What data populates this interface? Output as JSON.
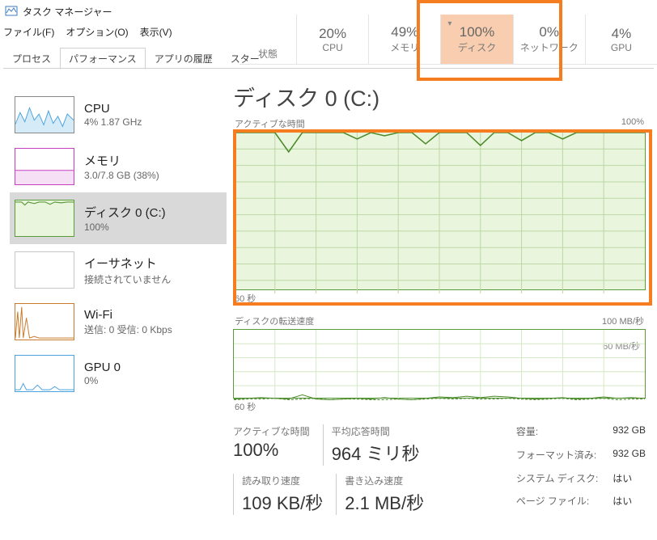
{
  "window": {
    "title": "タスク マネージャー"
  },
  "menu": {
    "file": "ファイル(F)",
    "options": "オプション(O)",
    "view": "表示(V)"
  },
  "tabs": {
    "processes": "プロセス",
    "performance": "パフォーマンス",
    "history": "アプリの履歴",
    "startup": "スター"
  },
  "top_metrics": {
    "status_label": "状態",
    "cpu": {
      "val": "20%",
      "label": "CPU"
    },
    "memory": {
      "val": "49%",
      "label": "メモリ"
    },
    "disk": {
      "val": "100%",
      "label": "ディスク"
    },
    "net": {
      "val": "0%",
      "label": "ネットワーク"
    },
    "gpu": {
      "val": "4%",
      "label": "GPU"
    }
  },
  "sidebar": [
    {
      "title": "CPU",
      "sub": "4% 1.87 GHz",
      "color": "#4aa3df",
      "fill": "#d6ebf8"
    },
    {
      "title": "メモリ",
      "sub": "3.0/7.8 GB (38%)",
      "color": "#c63fbf",
      "fill": "#f6e0f5"
    },
    {
      "title": "ディスク 0 (C:)",
      "sub": "100%",
      "color": "#5a9a3a",
      "fill": "#eaf5de"
    },
    {
      "title": "イーサネット",
      "sub": "接続されていません",
      "color": "#b0b0b0",
      "fill": "#ffffff"
    },
    {
      "title": "Wi-Fi",
      "sub": "送信: 0 受信: 0 Kbps",
      "color": "#c97a2b",
      "fill": "#fff"
    },
    {
      "title": "GPU 0",
      "sub": "0%",
      "color": "#4aa3df",
      "fill": "#fff"
    }
  ],
  "page": {
    "title": "ディスク 0 (C:)",
    "chart1_label": "アクティブな時間",
    "chart1_max": "100%",
    "chart1_x": "60 秒",
    "chart2_label": "ディスクの転送速度",
    "chart2_max": "100 MB/秒",
    "chart2_y2": "60 MB/秒",
    "chart2_x": "60 秒"
  },
  "stats": {
    "active_label": "アクティブな時間",
    "active_value": "100%",
    "avg_label": "平均応答時間",
    "avg_value": "964 ミリ秒",
    "read_label": "読み取り速度",
    "read_value": "109 KB/秒",
    "write_label": "書き込み速度",
    "write_value": "2.1 MB/秒",
    "capacity_k": "容量:",
    "capacity_v": "932 GB",
    "formatted_k": "フォーマット済み:",
    "formatted_v": "932 GB",
    "sysdisk_k": "システム ディスク:",
    "sysdisk_v": "はい",
    "pagefile_k": "ページ ファイル:",
    "pagefile_v": "はい"
  },
  "chart_data": [
    {
      "type": "line",
      "title": "アクティブな時間",
      "ylabel": "%",
      "ylim": [
        0,
        100
      ],
      "xlabel": "秒",
      "xlim": [
        0,
        60
      ],
      "x": [
        0,
        2,
        4,
        6,
        8,
        10,
        12,
        14,
        16,
        18,
        20,
        22,
        24,
        26,
        28,
        30,
        32,
        34,
        36,
        38,
        40,
        42,
        44,
        46,
        48,
        50,
        52,
        54,
        56,
        58,
        60
      ],
      "values": [
        100,
        100,
        100,
        100,
        88,
        100,
        100,
        100,
        100,
        96,
        100,
        98,
        100,
        100,
        93,
        100,
        100,
        100,
        92,
        100,
        100,
        95,
        100,
        100,
        96,
        100,
        100,
        100,
        100,
        100,
        100
      ]
    },
    {
      "type": "line",
      "title": "ディスクの転送速度",
      "ylabel": "MB/秒",
      "ylim": [
        0,
        100
      ],
      "xlabel": "秒",
      "xlim": [
        0,
        60
      ],
      "series": [
        {
          "name": "read",
          "x": [
            0,
            2,
            4,
            6,
            8,
            10,
            12,
            14,
            16,
            18,
            20,
            22,
            24,
            26,
            28,
            30,
            32,
            34,
            36,
            38,
            40,
            42,
            44,
            46,
            48,
            50,
            52,
            54,
            56,
            58,
            60
          ],
          "values": [
            2,
            3,
            4,
            3,
            2,
            8,
            2,
            1,
            2,
            3,
            2,
            4,
            2,
            1,
            3,
            5,
            4,
            6,
            4,
            6,
            5,
            3,
            2,
            3,
            4,
            2,
            3,
            5,
            3,
            4,
            3
          ]
        },
        {
          "name": "write",
          "x": [
            0,
            2,
            4,
            6,
            8,
            10,
            12,
            14,
            16,
            18,
            20,
            22,
            24,
            26,
            28,
            30,
            32,
            34,
            36,
            38,
            40,
            42,
            44,
            46,
            48,
            50,
            52,
            54,
            56,
            58,
            60
          ],
          "values": [
            1,
            2,
            2,
            3,
            1,
            2,
            3,
            1,
            2,
            2,
            1,
            1,
            2,
            1,
            2,
            3,
            2,
            3,
            2,
            2,
            3,
            2,
            1,
            2,
            3,
            1,
            2,
            3,
            1,
            2,
            2
          ]
        }
      ]
    }
  ]
}
